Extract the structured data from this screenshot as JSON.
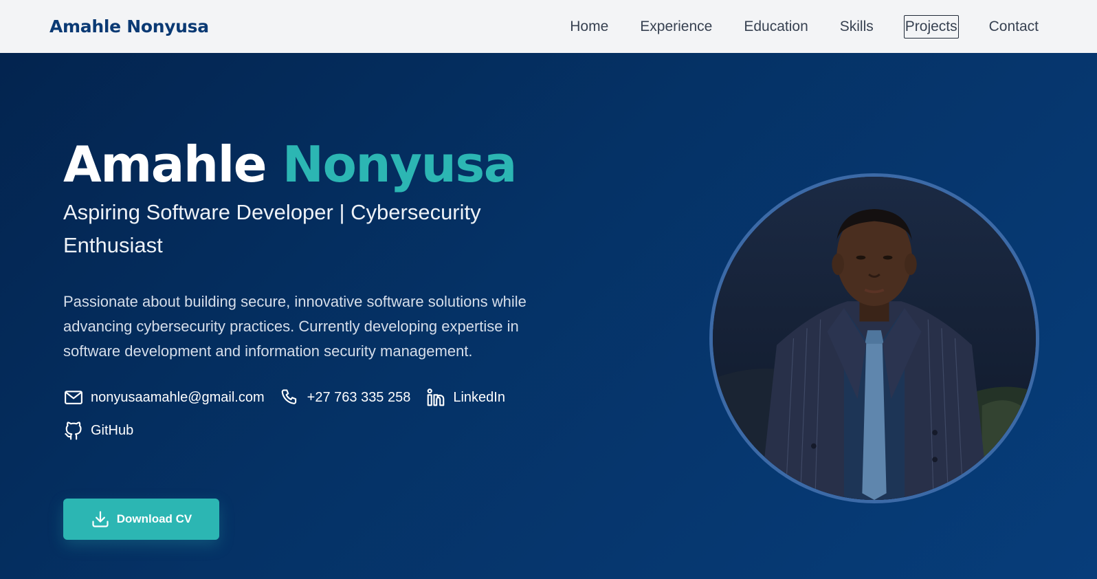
{
  "nav": {
    "brand": "Amahle Nonyusa",
    "links": [
      {
        "label": "Home"
      },
      {
        "label": "Experience"
      },
      {
        "label": "Education"
      },
      {
        "label": "Skills"
      },
      {
        "label": "Projects"
      },
      {
        "label": "Contact"
      }
    ]
  },
  "hero": {
    "first_name": "Amahle",
    "last_name": "Nonyusa",
    "subtitle": "Aspiring Software Developer | Cybersecurity Enthusiast",
    "description": "Passionate about building secure, innovative software solutions while advancing cybersecurity practices. Currently developing expertise in software development and information security management.",
    "contacts": {
      "email": {
        "label": "nonyusaamahle@gmail.com",
        "icon": "mail-icon"
      },
      "phone": {
        "label": "+27 763 335 258",
        "icon": "phone-icon"
      },
      "linkedin": {
        "label": "LinkedIn",
        "icon": "linkedin-icon"
      },
      "github": {
        "label": "GitHub",
        "icon": "github-icon"
      }
    },
    "download_button": {
      "label": "Download CV",
      "icon": "download-icon"
    }
  },
  "colors": {
    "brand": "#0b3a74",
    "accent": "#2cb6b3",
    "hero_bg": "#053266",
    "nav_bg": "#f3f4f6"
  }
}
